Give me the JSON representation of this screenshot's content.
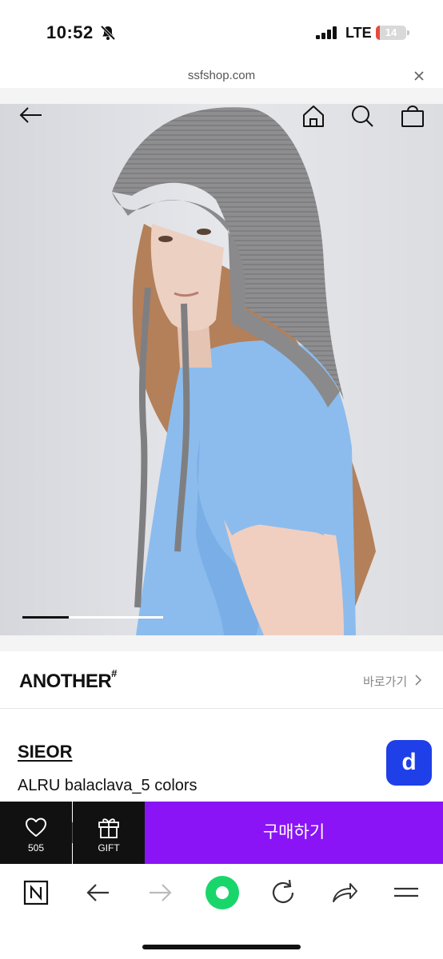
{
  "status_bar": {
    "time": "10:52",
    "network": "LTE",
    "battery": "14",
    "battery_level": 0.14
  },
  "browser": {
    "url": "ssfshop.com"
  },
  "hero": {
    "gallery_progress": 0.33
  },
  "brand": {
    "name": "ANOTHER",
    "mark": "#",
    "link_label": "바로가기"
  },
  "product": {
    "seller": "SIEOR",
    "name": "ALRU balaclava_5 colors",
    "floating_badge": "d"
  },
  "actions": {
    "like_count": "505",
    "gift_label": "GIFT",
    "buy_label": "구매하기"
  },
  "colors": {
    "buy_button": "#8a14f5",
    "floating_badge": "#1f3fe8",
    "browser_home": "#19d66b"
  }
}
